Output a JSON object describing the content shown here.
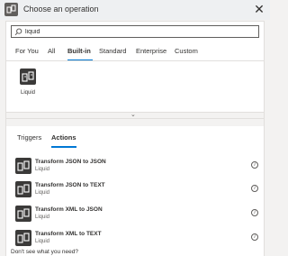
{
  "header": {
    "title": "Choose an operation",
    "icon": "operation-icon",
    "close": "✕"
  },
  "search": {
    "value": "liquid",
    "icon": "search-icon"
  },
  "category_tabs": [
    {
      "label": "For You",
      "active": false
    },
    {
      "label": "All",
      "active": false
    },
    {
      "label": "Built-in",
      "active": true
    },
    {
      "label": "Standard",
      "active": false
    },
    {
      "label": "Enterprise",
      "active": false
    },
    {
      "label": "Custom",
      "active": false
    }
  ],
  "connectors": [
    {
      "label": "Liquid",
      "icon": "liquid-icon"
    }
  ],
  "type_tabs": [
    {
      "label": "Triggers",
      "active": false
    },
    {
      "label": "Actions",
      "active": true
    }
  ],
  "actions": [
    {
      "name": "Transform JSON to JSON",
      "connector": "Liquid"
    },
    {
      "name": "Transform JSON to TEXT",
      "connector": "Liquid"
    },
    {
      "name": "Transform XML to JSON",
      "connector": "Liquid"
    },
    {
      "name": "Transform XML to TEXT",
      "connector": "Liquid"
    }
  ],
  "footer": "Don't see what you need?",
  "colors": {
    "accent": "#0078d4",
    "tile": "#3b3a39",
    "background": "#f3f2f1"
  }
}
